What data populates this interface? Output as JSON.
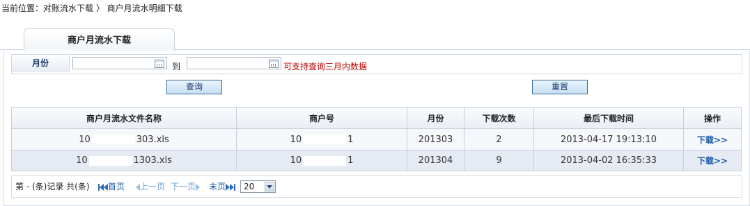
{
  "breadcrumb": "当前位置：对账流水下载 〉 商户月流水明细下载",
  "tab": {
    "label": "商户月流水下载"
  },
  "filter": {
    "month_label": "月份",
    "start_value": "",
    "to_label": "到",
    "end_value": "",
    "hint": "可支持查询三月内数据"
  },
  "buttons": {
    "query": "查询",
    "reset": "重置"
  },
  "table": {
    "headers": [
      "商户月流水文件名称",
      "商户号",
      "月份",
      "下载次数",
      "最后下载时间",
      "操作"
    ],
    "rows": [
      {
        "file_prefix": "10",
        "file_suffix": "303.xls",
        "merchant_prefix": "10",
        "merchant_suffix": "1",
        "month": "201303",
        "downloads": "2",
        "last_time": "2013-04-17 19:13:10",
        "action": "下载>>"
      },
      {
        "file_prefix": "10",
        "file_suffix": "1303.xls",
        "merchant_prefix": "10",
        "merchant_suffix": "1",
        "month": "201304",
        "downloads": "9",
        "last_time": "2013-04-02 16:35:33",
        "action": "下载>>"
      }
    ]
  },
  "pager": {
    "summary": "第 - (条)记录 共(条)",
    "first": "首页",
    "prev": "上一页",
    "next": "下一页",
    "last": "末页",
    "page_size": "20"
  },
  "colors": {
    "accent": "#1a5aa8",
    "hint": "#c00000"
  }
}
